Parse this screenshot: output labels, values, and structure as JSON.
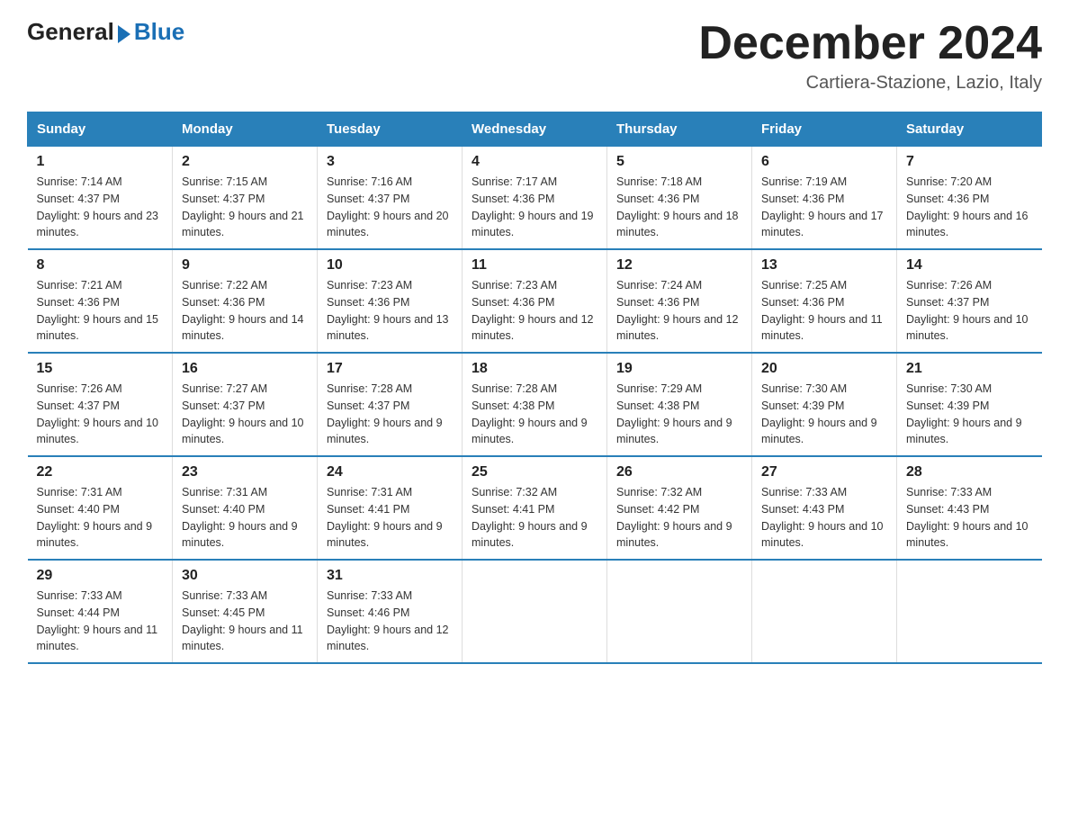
{
  "logo": {
    "general": "General",
    "blue": "Blue"
  },
  "header": {
    "month": "December 2024",
    "location": "Cartiera-Stazione, Lazio, Italy"
  },
  "days_of_week": [
    "Sunday",
    "Monday",
    "Tuesday",
    "Wednesday",
    "Thursday",
    "Friday",
    "Saturday"
  ],
  "weeks": [
    [
      {
        "day": "1",
        "sunrise": "7:14 AM",
        "sunset": "4:37 PM",
        "daylight": "9 hours and 23 minutes."
      },
      {
        "day": "2",
        "sunrise": "7:15 AM",
        "sunset": "4:37 PM",
        "daylight": "9 hours and 21 minutes."
      },
      {
        "day": "3",
        "sunrise": "7:16 AM",
        "sunset": "4:37 PM",
        "daylight": "9 hours and 20 minutes."
      },
      {
        "day": "4",
        "sunrise": "7:17 AM",
        "sunset": "4:36 PM",
        "daylight": "9 hours and 19 minutes."
      },
      {
        "day": "5",
        "sunrise": "7:18 AM",
        "sunset": "4:36 PM",
        "daylight": "9 hours and 18 minutes."
      },
      {
        "day": "6",
        "sunrise": "7:19 AM",
        "sunset": "4:36 PM",
        "daylight": "9 hours and 17 minutes."
      },
      {
        "day": "7",
        "sunrise": "7:20 AM",
        "sunset": "4:36 PM",
        "daylight": "9 hours and 16 minutes."
      }
    ],
    [
      {
        "day": "8",
        "sunrise": "7:21 AM",
        "sunset": "4:36 PM",
        "daylight": "9 hours and 15 minutes."
      },
      {
        "day": "9",
        "sunrise": "7:22 AM",
        "sunset": "4:36 PM",
        "daylight": "9 hours and 14 minutes."
      },
      {
        "day": "10",
        "sunrise": "7:23 AM",
        "sunset": "4:36 PM",
        "daylight": "9 hours and 13 minutes."
      },
      {
        "day": "11",
        "sunrise": "7:23 AM",
        "sunset": "4:36 PM",
        "daylight": "9 hours and 12 minutes."
      },
      {
        "day": "12",
        "sunrise": "7:24 AM",
        "sunset": "4:36 PM",
        "daylight": "9 hours and 12 minutes."
      },
      {
        "day": "13",
        "sunrise": "7:25 AM",
        "sunset": "4:36 PM",
        "daylight": "9 hours and 11 minutes."
      },
      {
        "day": "14",
        "sunrise": "7:26 AM",
        "sunset": "4:37 PM",
        "daylight": "9 hours and 10 minutes."
      }
    ],
    [
      {
        "day": "15",
        "sunrise": "7:26 AM",
        "sunset": "4:37 PM",
        "daylight": "9 hours and 10 minutes."
      },
      {
        "day": "16",
        "sunrise": "7:27 AM",
        "sunset": "4:37 PM",
        "daylight": "9 hours and 10 minutes."
      },
      {
        "day": "17",
        "sunrise": "7:28 AM",
        "sunset": "4:37 PM",
        "daylight": "9 hours and 9 minutes."
      },
      {
        "day": "18",
        "sunrise": "7:28 AM",
        "sunset": "4:38 PM",
        "daylight": "9 hours and 9 minutes."
      },
      {
        "day": "19",
        "sunrise": "7:29 AM",
        "sunset": "4:38 PM",
        "daylight": "9 hours and 9 minutes."
      },
      {
        "day": "20",
        "sunrise": "7:30 AM",
        "sunset": "4:39 PM",
        "daylight": "9 hours and 9 minutes."
      },
      {
        "day": "21",
        "sunrise": "7:30 AM",
        "sunset": "4:39 PM",
        "daylight": "9 hours and 9 minutes."
      }
    ],
    [
      {
        "day": "22",
        "sunrise": "7:31 AM",
        "sunset": "4:40 PM",
        "daylight": "9 hours and 9 minutes."
      },
      {
        "day": "23",
        "sunrise": "7:31 AM",
        "sunset": "4:40 PM",
        "daylight": "9 hours and 9 minutes."
      },
      {
        "day": "24",
        "sunrise": "7:31 AM",
        "sunset": "4:41 PM",
        "daylight": "9 hours and 9 minutes."
      },
      {
        "day": "25",
        "sunrise": "7:32 AM",
        "sunset": "4:41 PM",
        "daylight": "9 hours and 9 minutes."
      },
      {
        "day": "26",
        "sunrise": "7:32 AM",
        "sunset": "4:42 PM",
        "daylight": "9 hours and 9 minutes."
      },
      {
        "day": "27",
        "sunrise": "7:33 AM",
        "sunset": "4:43 PM",
        "daylight": "9 hours and 10 minutes."
      },
      {
        "day": "28",
        "sunrise": "7:33 AM",
        "sunset": "4:43 PM",
        "daylight": "9 hours and 10 minutes."
      }
    ],
    [
      {
        "day": "29",
        "sunrise": "7:33 AM",
        "sunset": "4:44 PM",
        "daylight": "9 hours and 11 minutes."
      },
      {
        "day": "30",
        "sunrise": "7:33 AM",
        "sunset": "4:45 PM",
        "daylight": "9 hours and 11 minutes."
      },
      {
        "day": "31",
        "sunrise": "7:33 AM",
        "sunset": "4:46 PM",
        "daylight": "9 hours and 12 minutes."
      },
      null,
      null,
      null,
      null
    ]
  ]
}
